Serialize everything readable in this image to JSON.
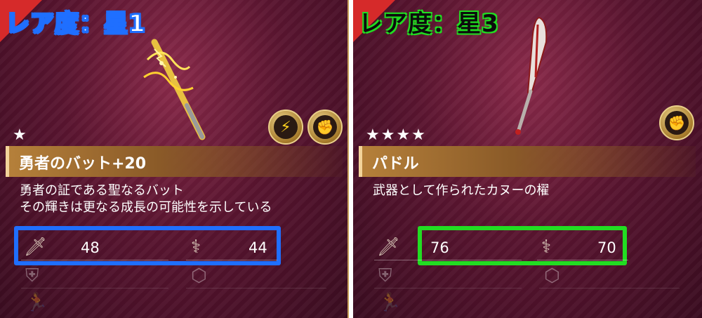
{
  "left": {
    "rarity_label": "レア度：星1",
    "stars": "★",
    "weapon_name": "勇者のバット+20",
    "description_line1": "勇者の証である聖なるバット",
    "description_line2": "その輝きは更なる成長の可能性を示している",
    "attack": "48",
    "magic": "44",
    "highlight_color": "#1f6fff",
    "badges": [
      "lightning-icon",
      "fist-icon"
    ]
  },
  "right": {
    "rarity_label": "レア度：星3",
    "stars": "★★★★",
    "weapon_name": "パドル",
    "description_line1": "武器として作られたカヌーの櫂",
    "attack": "76",
    "magic": "70",
    "highlight_color": "#22dd22",
    "badges": [
      "fist-icon"
    ]
  },
  "colors": {
    "name_bar": "#b5803a",
    "corner": "#d62a2a",
    "background": "#5a1530"
  }
}
